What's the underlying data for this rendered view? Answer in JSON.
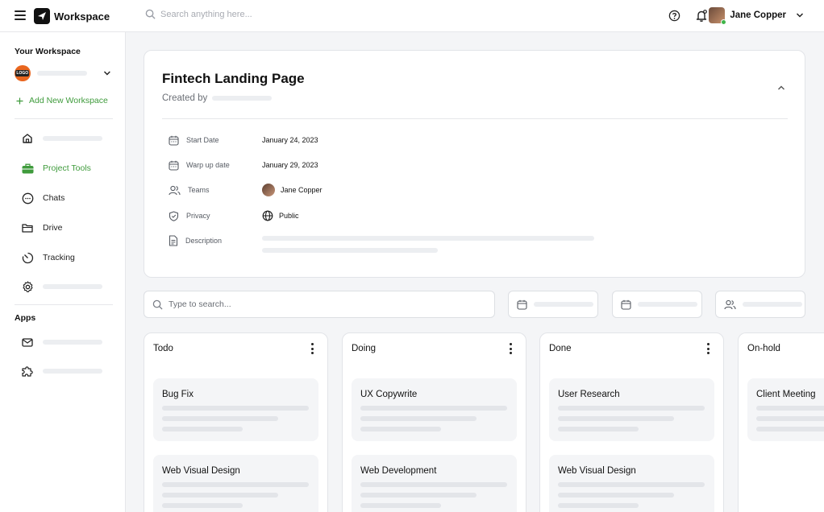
{
  "app": {
    "name": "Workspace"
  },
  "header": {
    "search_placeholder": "Search anything here...",
    "user_name": "Jane Copper"
  },
  "sidebar": {
    "workspace_heading": "Your Workspace",
    "workspace_logo_text": "LOGO",
    "add_workspace": "Add New Workspace",
    "nav": [
      {
        "label": "",
        "icon": "home-icon"
      },
      {
        "label": "Project Tools",
        "icon": "briefcase-icon",
        "active": true
      },
      {
        "label": "Chats",
        "icon": "chat-icon"
      },
      {
        "label": "Drive",
        "icon": "folder-icon"
      },
      {
        "label": "Tracking",
        "icon": "tracking-icon"
      },
      {
        "label": "",
        "icon": "gear-icon"
      }
    ],
    "apps_heading": "Apps",
    "apps": [
      {
        "label": "",
        "icon": "mail-icon"
      },
      {
        "label": "",
        "icon": "puzzle-icon"
      }
    ]
  },
  "project": {
    "title": "Fintech Landing Page",
    "created_by_label": "Created by",
    "details": [
      {
        "label": "Start Date",
        "value": "January 24, 2023",
        "icon": "calendar-icon"
      },
      {
        "label": "Warp up date",
        "value": "January 29, 2023",
        "icon": "calendar-icon"
      },
      {
        "label": "Teams",
        "value": "Jane Copper",
        "icon": "users-icon"
      },
      {
        "label": "Privacy",
        "value": "Public",
        "icon": "shield-icon"
      },
      {
        "label": "Description",
        "value": "",
        "icon": "document-icon"
      }
    ]
  },
  "filters": {
    "search_placeholder": "Type to search..."
  },
  "board": {
    "columns": [
      {
        "title": "Todo",
        "tasks": [
          "Bug Fix",
          "Web Visual Design"
        ]
      },
      {
        "title": "Doing",
        "tasks": [
          "UX Copywrite",
          "Web Development"
        ]
      },
      {
        "title": "Done",
        "tasks": [
          "User Research",
          "Web Visual Design"
        ]
      },
      {
        "title": "On-hold",
        "tasks": [
          "Client Meeting"
        ]
      }
    ]
  },
  "colors": {
    "accent": "#3f9b3c",
    "status_online": "#3fb54a",
    "workspace_logo": "#e9661f"
  }
}
